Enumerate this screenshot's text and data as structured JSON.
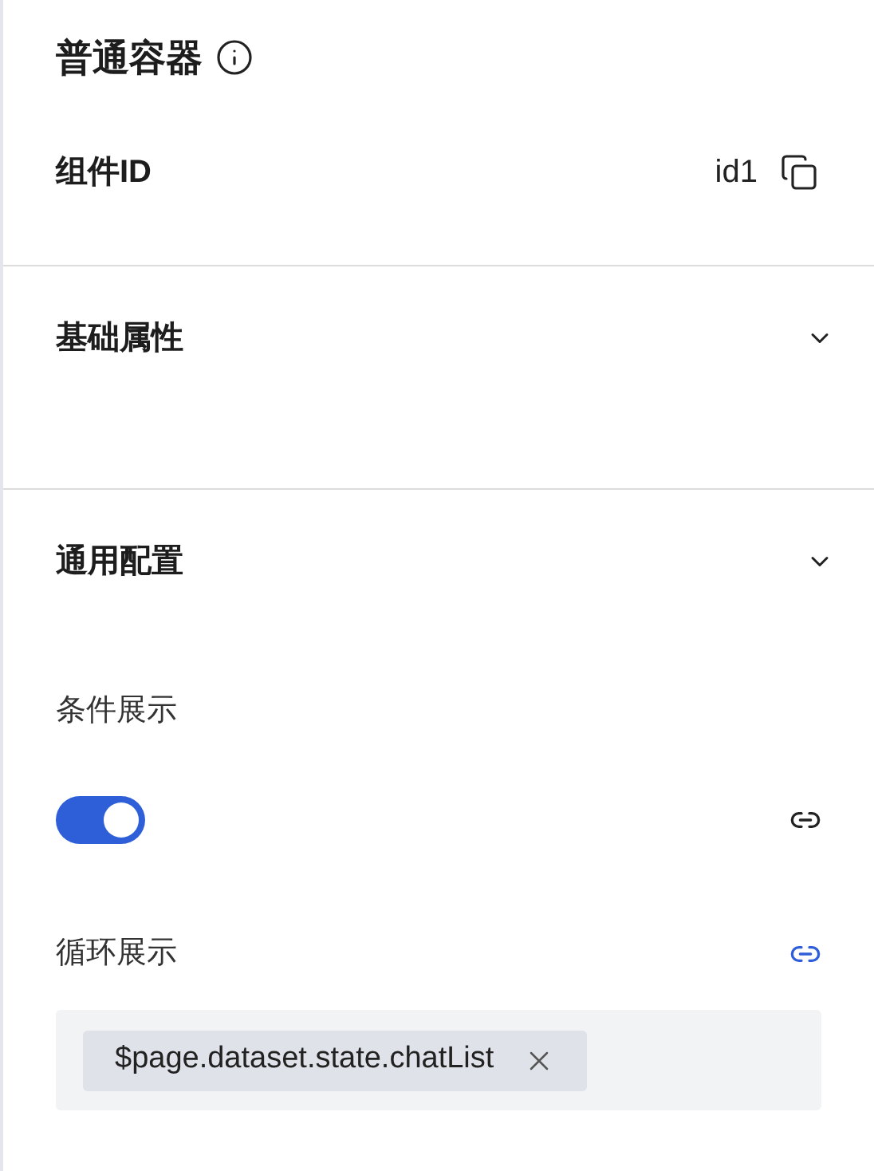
{
  "title": "普通容器",
  "component_id": {
    "label": "组件ID",
    "value": "id1"
  },
  "sections": [
    {
      "title": "基础属性"
    },
    {
      "title": "通用配置",
      "fields": [
        {
          "kind": "toggle",
          "label": "条件展示",
          "on": true,
          "bound": false
        },
        {
          "kind": "tags",
          "label": "循环展示",
          "bound": true,
          "tags": [
            "$page.dataset.state.chatList"
          ]
        }
      ]
    }
  ]
}
